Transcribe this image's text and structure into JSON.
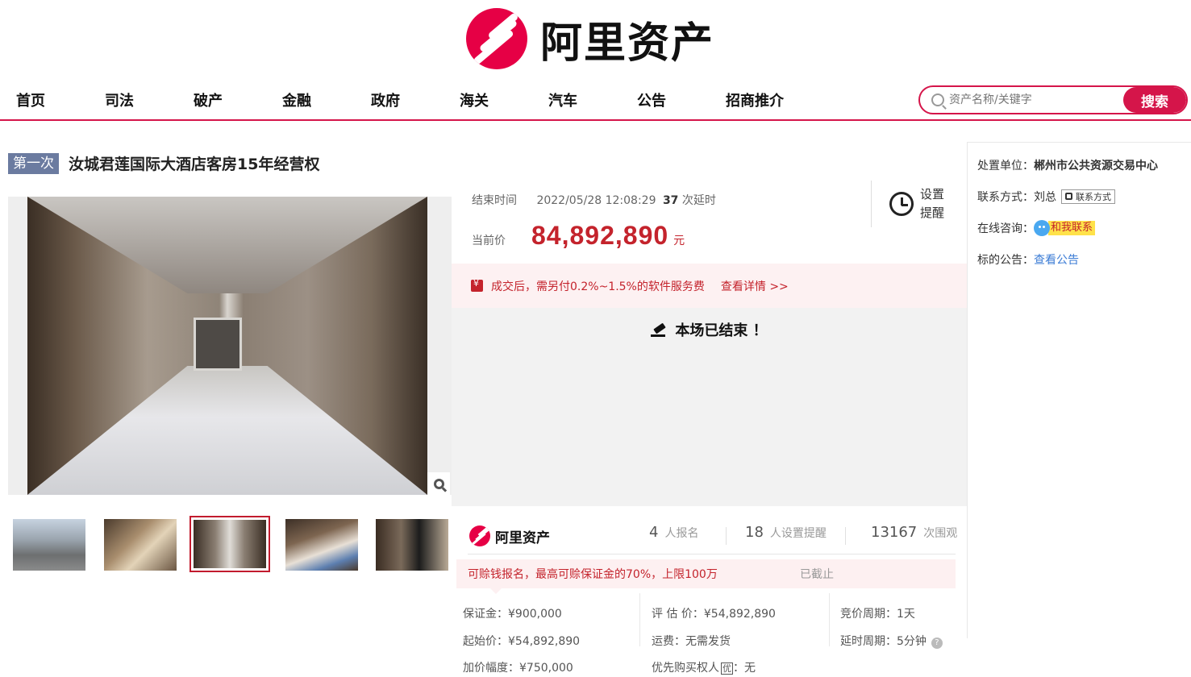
{
  "header": {
    "logo_text": "阿里资产",
    "nav": [
      "首页",
      "司法",
      "破产",
      "金融",
      "政府",
      "海关",
      "汽车",
      "公告",
      "招商推介"
    ],
    "search": {
      "placeholder": "资产名称/关键字",
      "button": "搜索"
    }
  },
  "item": {
    "round_tag": "第一次",
    "title": "汝城君莲国际大酒店客房15年经营权"
  },
  "auction": {
    "end_label": "结束时间",
    "end_time": "2022/05/28 12:08:29",
    "delay_count": "37",
    "delay_label": "次延时",
    "price_label": "当前价",
    "current_price": "84,892,890",
    "price_unit": "元",
    "reminder_label": "设置提醒",
    "fee_text": "成交后，需另付0.2%~1.5%的软件服务费",
    "fee_link": "查看详情 >>",
    "ended_text": "本场已结束 ！"
  },
  "stats": {
    "brand": "阿里资产",
    "signups": "4",
    "signups_label": "人报名",
    "reminders": "18",
    "reminders_label": "人设置提醒",
    "views": "13167",
    "views_label": "次围观"
  },
  "deposit": {
    "text": "可赊钱报名，最高可赊保证金的70%，上限100万",
    "status": "已截止"
  },
  "details": {
    "deposit": "保证金：¥900,000",
    "appraisal": "评 估 价：¥54,892,890",
    "bid_period": "竞价周期：1天",
    "start_price": "起始价：¥54,892,890",
    "shipping": "运费：无需发货",
    "delay_period": "延时周期：5分钟",
    "increment": "加价幅度：¥750,000",
    "priority_label": "优先购买权人",
    "priority_icon": "优",
    "priority_value": "：无"
  },
  "sidebar": {
    "unit_label": "处置单位：",
    "unit_value": "郴州市公共资源交易中心",
    "contact_label": "联系方式：",
    "contact_name": "刘总",
    "contact_button": "联系方式",
    "consult_label": "在线咨询：",
    "consult_button": "和我联系",
    "notice_label": "标的公告：",
    "notice_link": "查看公告"
  },
  "colors": {
    "brand": "#e60045",
    "accent": "#d5154a",
    "price": "#c4232c",
    "tag": "#6b7ba0"
  }
}
